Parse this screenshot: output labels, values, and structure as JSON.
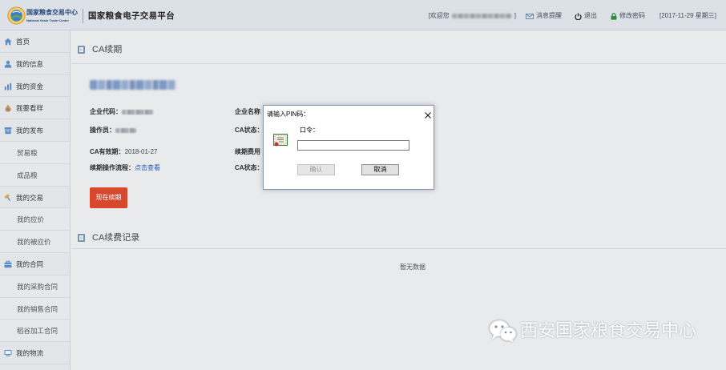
{
  "header": {
    "logo_name": "国家粮食交易中心",
    "logo_name_en": "National Grain Trade Center",
    "platform_title": "国家粮食电子交易平台",
    "welcome_prefix": "[欢迎您",
    "welcome_suffix": "]",
    "messages_label": "消息提醒",
    "logout_label": "退出",
    "change_password_label": "修改密码",
    "date_text": "[2017-11-29 星期三]",
    "icons": {
      "messages": "envelope-icon",
      "logout": "power-icon",
      "change_password": "lock-icon"
    }
  },
  "sidebar": {
    "items": [
      {
        "label": "首页",
        "icon": "home-icon"
      },
      {
        "label": "我的信息",
        "icon": "user-icon"
      },
      {
        "label": "我的资金",
        "icon": "bar-chart-icon"
      },
      {
        "label": "我要看样",
        "icon": "drop-icon"
      },
      {
        "label": "我的发布",
        "icon": "archive-icon"
      },
      {
        "label": "贸易粮"
      },
      {
        "label": "成品粮"
      },
      {
        "label": "我的交易",
        "icon": "gavel-icon"
      },
      {
        "label": "我的应价"
      },
      {
        "label": "我的被应价"
      },
      {
        "label": "我的合同",
        "icon": "briefcase-icon"
      },
      {
        "label": "我的采购合同"
      },
      {
        "label": "我的销售合同"
      },
      {
        "label": "稻谷加工合同"
      },
      {
        "label": "我的物流",
        "icon": "monitor-icon"
      }
    ]
  },
  "main": {
    "ca_renewal": {
      "title": "CA续期",
      "company_code_label": "企业代码：",
      "operator_label": "操作员：",
      "ca_expiry_label": "CA有效期：",
      "ca_expiry_value": "2018-01-27",
      "renewal_process_label": "续期操作流程：",
      "renewal_process_link": "点击查看",
      "company_name_label": "企业名称",
      "ca_status_label": "CA状态：",
      "renewal_fee_label": "续期费用",
      "ca_status_label_2": "CA状态：",
      "renew_button": "现在续期"
    },
    "ca_fee_records": {
      "title": "CA续费记录",
      "empty_text": "暂无数据"
    },
    "watermark": "西安国家粮食交易中心"
  },
  "dialog": {
    "title": "请输入PIN码：",
    "pin_label": "口令：",
    "pin_value": "",
    "confirm_label": "确认",
    "cancel_label": "取消",
    "confirm_disabled": true
  },
  "colors": {
    "renew_button": "#d8482d",
    "link": "#2457b7"
  }
}
